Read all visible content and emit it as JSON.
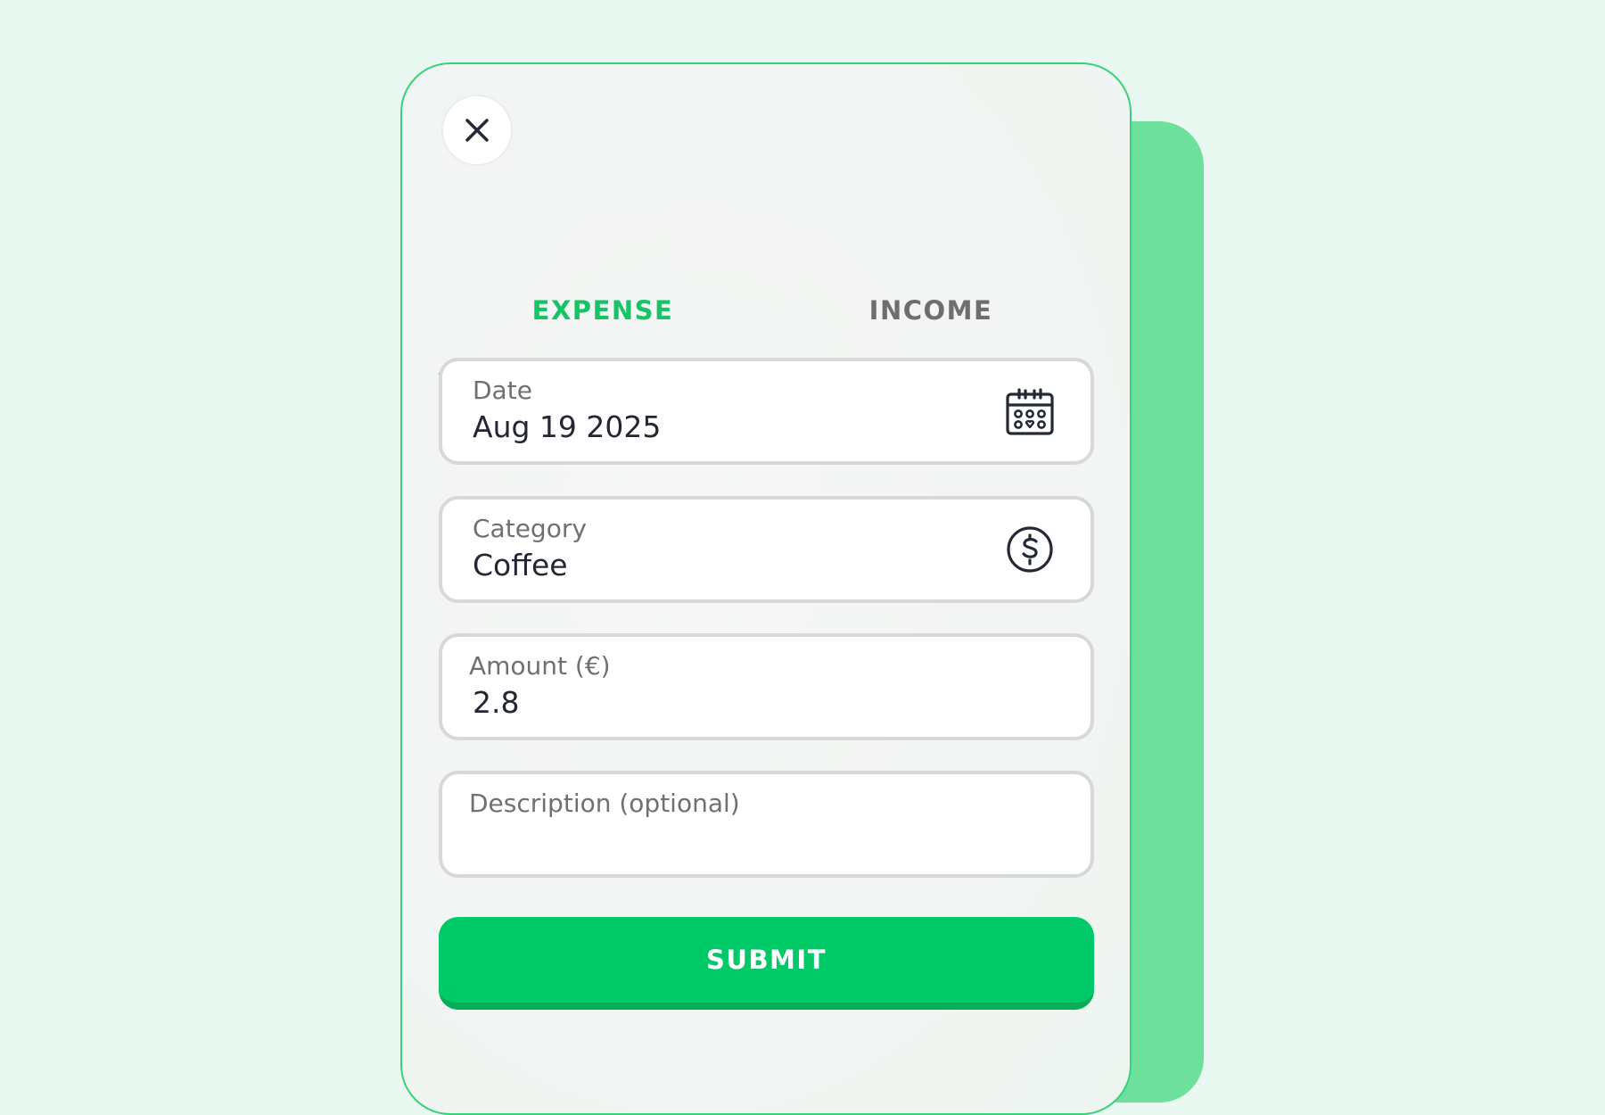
{
  "tabs": {
    "expense_label": "EXPENSE",
    "income_label": "INCOME",
    "active": "expense"
  },
  "form": {
    "date": {
      "label": "Date",
      "value": "Aug 19 2025",
      "icon": "calendar-icon"
    },
    "category": {
      "label": "Category",
      "value": "Coffee",
      "icon": "dollar-circle-icon"
    },
    "amount": {
      "label": "Amount (€)",
      "value": "2.8"
    },
    "description": {
      "label": "Description (optional)",
      "value": ""
    }
  },
  "submit_label": "SUBMIT",
  "close_icon": "close-icon",
  "colors": {
    "accent": "#00c968",
    "accent_dark": "#07ad57",
    "background": "#e9f8f0",
    "back_card": "#6ce09c",
    "text_dark": "#222733",
    "text_muted": "#707070"
  }
}
